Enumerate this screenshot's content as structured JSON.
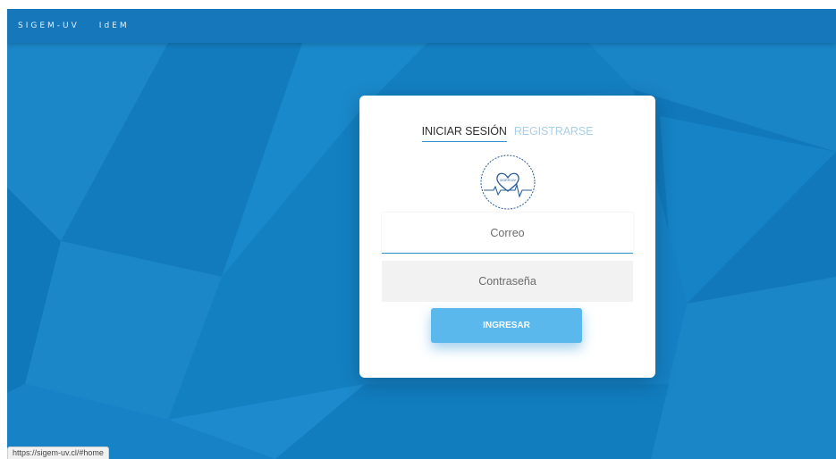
{
  "colors": {
    "background": "#1580c4",
    "navbar": "#1677bb",
    "card": "#ffffff",
    "tab_active": "#2e2e2e",
    "tab_inactive": "#a9cfe9",
    "accent_line": "#3f8fc8",
    "button": "#5ab8ec",
    "password_field_bg": "#f2f2f2"
  },
  "navbar": {
    "links": [
      {
        "label": "SIGEM-UV"
      },
      {
        "label": "IdEM"
      }
    ]
  },
  "login": {
    "tabs": [
      {
        "label": "INICIAR SESIÓN",
        "active": true
      },
      {
        "label": "REGISTRARSE",
        "active": false
      }
    ],
    "logo": {
      "icon": "heart-pulse-icon",
      "text": "SIGEM-UV"
    },
    "email": {
      "placeholder": "Correo",
      "value": ""
    },
    "password": {
      "placeholder": "Contraseña",
      "value": ""
    },
    "submit_label": "INGRESAR"
  },
  "status_bar": {
    "url": "https://sigem-uv.cl/#home"
  }
}
